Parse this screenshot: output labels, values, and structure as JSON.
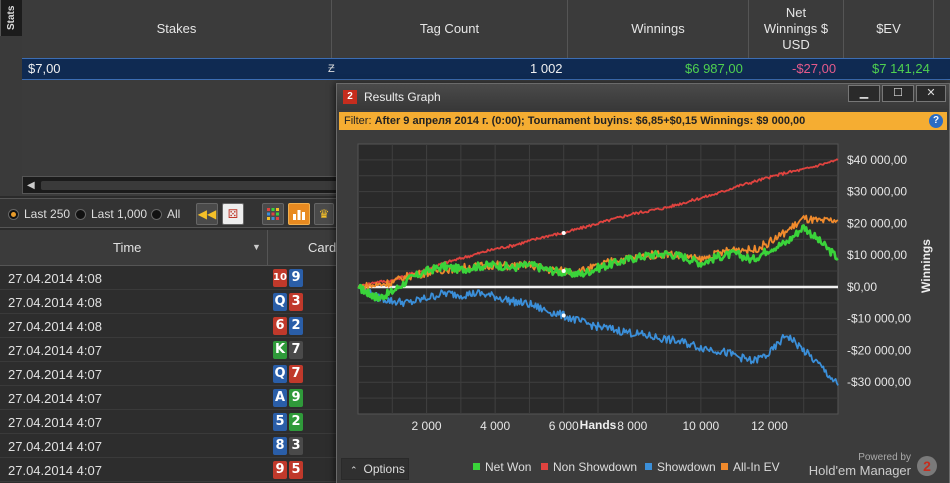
{
  "stats_panel": {
    "tab_label": "Stats",
    "columns": [
      "Stakes",
      "Tag Count",
      "Winnings",
      "Net Winnings $ USD",
      "$EV"
    ],
    "row": {
      "stakes": "$7,00",
      "tag": "Ƶ",
      "count": "1 002",
      "winnings": "$6 987,00",
      "net_winnings": "-$27,00",
      "ev": "$7 141,24"
    }
  },
  "filter_bar": {
    "options": [
      "Last 250",
      "Last 1,000",
      "All"
    ],
    "selected": "Last 250"
  },
  "hands_table": {
    "columns": [
      "Time",
      "Card"
    ],
    "rows": [
      {
        "time": "27.04.2014 4:08",
        "cards": [
          {
            "r": "10",
            "c": "#c0392b"
          },
          {
            "r": "9",
            "c": "#2a5ea8"
          }
        ]
      },
      {
        "time": "27.04.2014 4:08",
        "cards": [
          {
            "r": "Q",
            "c": "#2a5ea8"
          },
          {
            "r": "3",
            "c": "#c0392b"
          }
        ]
      },
      {
        "time": "27.04.2014 4:08",
        "cards": [
          {
            "r": "6",
            "c": "#c0392b"
          },
          {
            "r": "2",
            "c": "#2a5ea8"
          }
        ]
      },
      {
        "time": "27.04.2014 4:07",
        "cards": [
          {
            "r": "K",
            "c": "#2f9a3a"
          },
          {
            "r": "7",
            "c": "#4a4a4a"
          }
        ]
      },
      {
        "time": "27.04.2014 4:07",
        "cards": [
          {
            "r": "Q",
            "c": "#2a5ea8"
          },
          {
            "r": "7",
            "c": "#c0392b"
          }
        ]
      },
      {
        "time": "27.04.2014 4:07",
        "cards": [
          {
            "r": "A",
            "c": "#2a5ea8"
          },
          {
            "r": "9",
            "c": "#2f9a3a"
          }
        ]
      },
      {
        "time": "27.04.2014 4:07",
        "cards": [
          {
            "r": "5",
            "c": "#2a5ea8"
          },
          {
            "r": "2",
            "c": "#2f9a3a"
          }
        ]
      },
      {
        "time": "27.04.2014 4:07",
        "cards": [
          {
            "r": "8",
            "c": "#2a5ea8"
          },
          {
            "r": "3",
            "c": "#4a4a4a"
          }
        ]
      },
      {
        "time": "27.04.2014 4:07",
        "cards": [
          {
            "r": "9",
            "c": "#c0392b"
          },
          {
            "r": "5",
            "c": "#c0392b"
          }
        ]
      }
    ]
  },
  "results_graph": {
    "title": "Results Graph",
    "filter_prefix": "Filter:",
    "filter_text": "After 9 апреля 2014 г. (0:00); Tournament buyins: $6,85+$0,15 Winnings: $9 000,00",
    "options_label": "Options",
    "powered_by": "Powered by",
    "brand": "Hold'em Manager",
    "brand_logo": "2",
    "colors": {
      "net_won": "#3ad33a",
      "non_showdown": "#e0433f",
      "showdown": "#3b8fd9",
      "all_in_ev": "#f08a2c"
    }
  },
  "chart_data": {
    "type": "line",
    "xlabel": "Hands",
    "ylabel": "Winnings",
    "xlim": [
      0,
      14000
    ],
    "ylim": [
      -40000,
      45000
    ],
    "xticks": [
      2000,
      4000,
      6000,
      8000,
      10000,
      12000
    ],
    "xtick_labels": [
      "2 000",
      "4 000",
      "6 000",
      "8 000",
      "10 000",
      "12 000"
    ],
    "yticks": [
      40000,
      30000,
      20000,
      10000,
      0,
      -10000,
      -20000,
      -30000
    ],
    "ytick_labels": [
      "$40 000,00",
      "$30 000,00",
      "$20 000,00",
      "$10 000,00",
      "$0,00",
      "-$10 000,00",
      "-$20 000,00",
      "-$30 000,00"
    ],
    "grid": true,
    "legend_position": "bottom",
    "series": [
      {
        "name": "Net Won",
        "color": "#3ad33a",
        "points": [
          [
            0,
            0
          ],
          [
            300,
            -2000
          ],
          [
            600,
            -3500
          ],
          [
            1000,
            -1500
          ],
          [
            1500,
            2500
          ],
          [
            2000,
            5000
          ],
          [
            2500,
            6500
          ],
          [
            3000,
            5500
          ],
          [
            3500,
            6500
          ],
          [
            4000,
            7000
          ],
          [
            4500,
            6000
          ],
          [
            5000,
            7000
          ],
          [
            5500,
            5500
          ],
          [
            6000,
            4500
          ],
          [
            6500,
            4000
          ],
          [
            7000,
            6000
          ],
          [
            7500,
            7500
          ],
          [
            8000,
            9000
          ],
          [
            8500,
            10000
          ],
          [
            9000,
            10500
          ],
          [
            9500,
            9500
          ],
          [
            10000,
            7500
          ],
          [
            10500,
            9500
          ],
          [
            11000,
            10500
          ],
          [
            11500,
            8500
          ],
          [
            12000,
            12000
          ],
          [
            12500,
            14000
          ],
          [
            13000,
            19000
          ],
          [
            13500,
            14000
          ],
          [
            14000,
            9000
          ]
        ]
      },
      {
        "name": "Non Showdown",
        "color": "#e0433f",
        "points": [
          [
            0,
            0
          ],
          [
            500,
            1500
          ],
          [
            1000,
            2000
          ],
          [
            1500,
            4000
          ],
          [
            2000,
            5500
          ],
          [
            2500,
            7500
          ],
          [
            3000,
            9000
          ],
          [
            3500,
            10500
          ],
          [
            4000,
            12000
          ],
          [
            4500,
            13000
          ],
          [
            5000,
            14500
          ],
          [
            5500,
            16000
          ],
          [
            6000,
            17000
          ],
          [
            6500,
            18500
          ],
          [
            7000,
            20000
          ],
          [
            7500,
            21500
          ],
          [
            8000,
            23000
          ],
          [
            8500,
            24000
          ],
          [
            9000,
            25000
          ],
          [
            9500,
            26500
          ],
          [
            10000,
            28000
          ],
          [
            10500,
            29500
          ],
          [
            11000,
            31500
          ],
          [
            11500,
            33000
          ],
          [
            12000,
            34500
          ],
          [
            12500,
            36000
          ],
          [
            13000,
            37000
          ],
          [
            13500,
            38500
          ],
          [
            14000,
            40000
          ]
        ]
      },
      {
        "name": "Showdown",
        "color": "#3b8fd9",
        "points": [
          [
            0,
            0
          ],
          [
            500,
            -3000
          ],
          [
            1000,
            -4500
          ],
          [
            1500,
            -5000
          ],
          [
            2000,
            -3500
          ],
          [
            2500,
            -2000
          ],
          [
            3000,
            -2500
          ],
          [
            3500,
            -2000
          ],
          [
            4000,
            -3000
          ],
          [
            4500,
            -4500
          ],
          [
            5000,
            -5500
          ],
          [
            5500,
            -7500
          ],
          [
            6000,
            -9000
          ],
          [
            6500,
            -11000
          ],
          [
            7000,
            -12500
          ],
          [
            7500,
            -13500
          ],
          [
            8000,
            -14500
          ],
          [
            8500,
            -15500
          ],
          [
            9000,
            -16500
          ],
          [
            9500,
            -17500
          ],
          [
            10000,
            -19000
          ],
          [
            10500,
            -20000
          ],
          [
            11000,
            -21500
          ],
          [
            11500,
            -23500
          ],
          [
            12000,
            -21000
          ],
          [
            12500,
            -15000
          ],
          [
            13000,
            -20000
          ],
          [
            13500,
            -25000
          ],
          [
            14000,
            -31000
          ]
        ]
      },
      {
        "name": "All-In EV",
        "color": "#f08a2c",
        "points": [
          [
            0,
            0
          ],
          [
            500,
            500
          ],
          [
            1000,
            1500
          ],
          [
            1500,
            3500
          ],
          [
            2000,
            4500
          ],
          [
            2500,
            5500
          ],
          [
            3000,
            6000
          ],
          [
            3500,
            6500
          ],
          [
            4000,
            7000
          ],
          [
            4500,
            6500
          ],
          [
            5000,
            7000
          ],
          [
            5500,
            5500
          ],
          [
            6000,
            5000
          ],
          [
            6500,
            5000
          ],
          [
            7000,
            6500
          ],
          [
            7500,
            8500
          ],
          [
            8000,
            9000
          ],
          [
            8500,
            10000
          ],
          [
            9000,
            10500
          ],
          [
            9500,
            9500
          ],
          [
            10000,
            8500
          ],
          [
            10500,
            10500
          ],
          [
            11000,
            12000
          ],
          [
            11500,
            11500
          ],
          [
            12000,
            14000
          ],
          [
            12500,
            17500
          ],
          [
            13000,
            21500
          ],
          [
            13500,
            20500
          ],
          [
            14000,
            21000
          ]
        ]
      }
    ]
  }
}
